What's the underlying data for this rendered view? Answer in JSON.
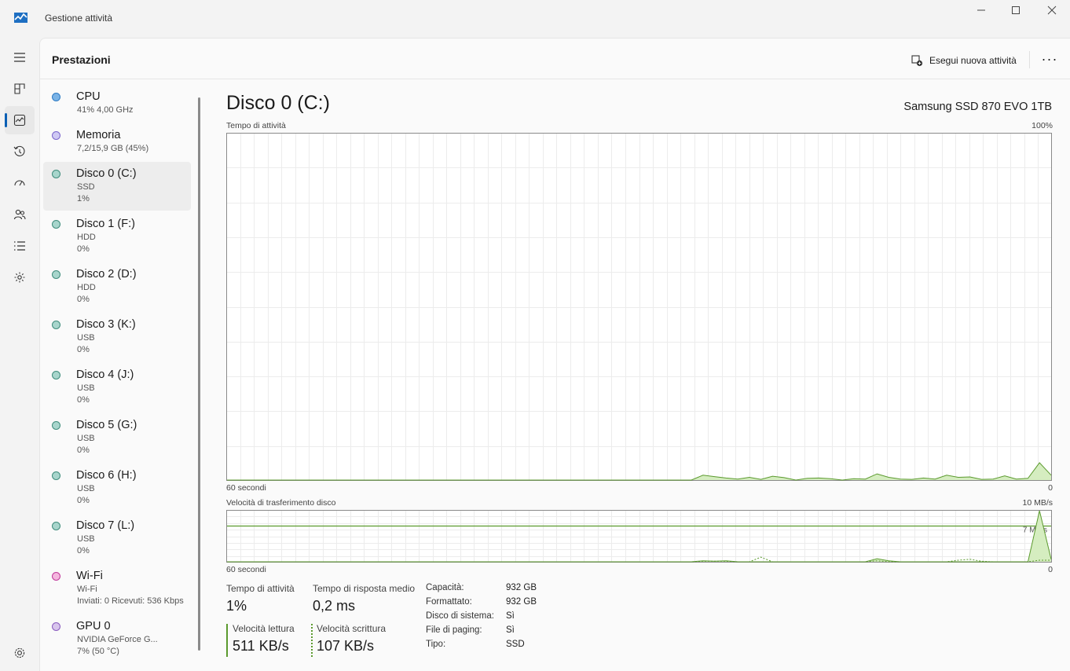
{
  "window": {
    "title": "Gestione attività",
    "buttons": [
      "minimize-icon",
      "maximize-icon",
      "close-icon"
    ]
  },
  "nav": {
    "items": [
      "hamburger-icon",
      "processes-icon",
      "performance-icon",
      "history-icon",
      "startup-icon",
      "users-icon",
      "details-icon",
      "services-icon",
      "settings-icon"
    ],
    "active": "performance-icon"
  },
  "header": {
    "title": "Prestazioni",
    "run_task_label": "Esegui nuova attività",
    "more_label": "···"
  },
  "devices": [
    {
      "name": "CPU",
      "lines": [
        "41% 4,00 GHz"
      ],
      "color": "#7ab3e6",
      "border": "#2e7bc4"
    },
    {
      "name": "Memoria",
      "lines": [
        "7,2/15,9 GB (45%)"
      ],
      "color": "#cfc9f3",
      "border": "#7a66cc"
    },
    {
      "name": "Disco 0 (C:)",
      "lines": [
        "SSD",
        "1%"
      ],
      "color": "#a8d5cc",
      "border": "#3f8c7c"
    },
    {
      "name": "Disco 1 (F:)",
      "lines": [
        "HDD",
        "0%"
      ],
      "color": "#a8d5cc",
      "border": "#3f8c7c"
    },
    {
      "name": "Disco 2 (D:)",
      "lines": [
        "HDD",
        "0%"
      ],
      "color": "#a8d5cc",
      "border": "#3f8c7c"
    },
    {
      "name": "Disco 3 (K:)",
      "lines": [
        "USB",
        "0%"
      ],
      "color": "#a8d5cc",
      "border": "#3f8c7c"
    },
    {
      "name": "Disco 4 (J:)",
      "lines": [
        "USB",
        "0%"
      ],
      "color": "#a8d5cc",
      "border": "#3f8c7c"
    },
    {
      "name": "Disco 5 (G:)",
      "lines": [
        "USB",
        "0%"
      ],
      "color": "#a8d5cc",
      "border": "#3f8c7c"
    },
    {
      "name": "Disco 6 (H:)",
      "lines": [
        "USB",
        "0%"
      ],
      "color": "#a8d5cc",
      "border": "#3f8c7c"
    },
    {
      "name": "Disco 7 (L:)",
      "lines": [
        "USB",
        "0%"
      ],
      "color": "#a8d5cc",
      "border": "#3f8c7c"
    },
    {
      "name": "Wi-Fi",
      "lines": [
        "Wi-Fi",
        "Inviati: 0 Ricevuti: 536 Kbps"
      ],
      "color": "#f4b6de",
      "border": "#c0399a"
    },
    {
      "name": "GPU 0",
      "lines": [
        "NVIDIA GeForce G...",
        "7% (50 °C)"
      ],
      "color": "#d8c5ec",
      "border": "#8a5cbf"
    }
  ],
  "selected_device": 2,
  "detail": {
    "title": "Disco 0 (C:)",
    "model": "Samsung SSD 870 EVO 1TB",
    "activity_graph": {
      "label": "Tempo di attività",
      "max_label": "100%",
      "x_left_label": "60 secondi",
      "x_right_label": "0"
    },
    "transfer_graph": {
      "label": "Velocità di trasferimento disco",
      "max_label": "10 MB/s",
      "inner_label": "7 MB/s",
      "x_left_label": "60 secondi",
      "x_right_label": "0"
    },
    "stats": {
      "active_time_label": "Tempo di attività",
      "active_time_value": "1%",
      "response_label": "Tempo di risposta medio",
      "response_value": "0,2 ms",
      "read_label": "Velocità lettura",
      "read_value": "511 KB/s",
      "write_label": "Velocità scrittura",
      "write_value": "107 KB/s"
    },
    "properties": [
      {
        "key": "Capacità:",
        "value": "932 GB"
      },
      {
        "key": "Formattato:",
        "value": "932 GB"
      },
      {
        "key": "Disco di sistema:",
        "value": "Sì"
      },
      {
        "key": "File di paging:",
        "value": "Sì"
      },
      {
        "key": "Tipo:",
        "value": "SSD"
      }
    ]
  },
  "chart_data": [
    {
      "type": "area",
      "title": "Tempo di attività",
      "x": [
        60,
        57,
        54,
        51,
        48,
        45,
        42,
        39,
        36,
        33,
        30,
        27,
        24,
        21,
        18,
        15,
        12,
        9,
        6,
        3,
        0
      ],
      "xlabel": "60 secondi",
      "ylim": [
        0,
        100
      ],
      "series": [
        {
          "values": [
            0,
            0,
            0,
            0,
            0,
            0,
            0,
            0,
            0,
            0,
            0,
            0,
            0,
            0,
            0,
            0,
            0,
            0,
            0,
            0,
            0,
            0,
            0,
            0,
            0,
            0,
            0,
            0,
            0,
            0,
            0,
            0,
            0,
            0,
            0,
            0,
            0,
            0,
            0,
            0,
            0,
            1.4,
            1.0,
            0.6,
            0.3,
            0.8,
            0.2,
            1.1,
            0.7,
            0,
            0.5,
            0.6,
            0.4,
            0,
            0.4,
            0.3,
            1.8,
            0.8,
            0.3,
            0.2,
            0.6,
            0.3,
            1.4,
            0.8,
            0.9,
            0.2,
            0.3,
            1.2,
            0.3,
            0.5,
            5.0,
            1.4
          ]
        }
      ],
      "color": "#5b9a2e"
    },
    {
      "type": "line",
      "title": "Velocità di trasferimento disco",
      "xlabel": "60 secondi",
      "ylim": [
        0,
        10
      ],
      "y_unit": "MB/s",
      "series": [
        {
          "name": "Velocità lettura",
          "style": "solid",
          "values": [
            0,
            0,
            0,
            0,
            0,
            0,
            0,
            0,
            0,
            0,
            0,
            0,
            0,
            0,
            0,
            0,
            0,
            0,
            0,
            0,
            0,
            0,
            0,
            0,
            0,
            0,
            0,
            0,
            0,
            0,
            0,
            0,
            0,
            0,
            0,
            0,
            0,
            0,
            0,
            0,
            0,
            0.2,
            0.1,
            0.2,
            0,
            0,
            0,
            0,
            0,
            0,
            0,
            0,
            0,
            0,
            0,
            0,
            0.6,
            0.2,
            0,
            0,
            0,
            0,
            0,
            0,
            0,
            0,
            0,
            0,
            0,
            0,
            10,
            0.5
          ]
        },
        {
          "name": "Velocità scrittura",
          "style": "dashed",
          "values": [
            0,
            0,
            0,
            0,
            0,
            0,
            0,
            0,
            0,
            0,
            0,
            0,
            0,
            0,
            0,
            0,
            0,
            0,
            0,
            0,
            0,
            0,
            0,
            0,
            0,
            0,
            0,
            0,
            0,
            0,
            0,
            0,
            0,
            0,
            0,
            0,
            0,
            0,
            0,
            0,
            0,
            0.1,
            0.1,
            0.1,
            0,
            0,
            0.9,
            0,
            0,
            0,
            0,
            0,
            0,
            0,
            0,
            0,
            0.2,
            0,
            0,
            0,
            0,
            0,
            0,
            0.3,
            0.5,
            0.1,
            0,
            0,
            0,
            0,
            0.3,
            0.3
          ]
        }
      ],
      "color": "#5b9a2e"
    }
  ]
}
